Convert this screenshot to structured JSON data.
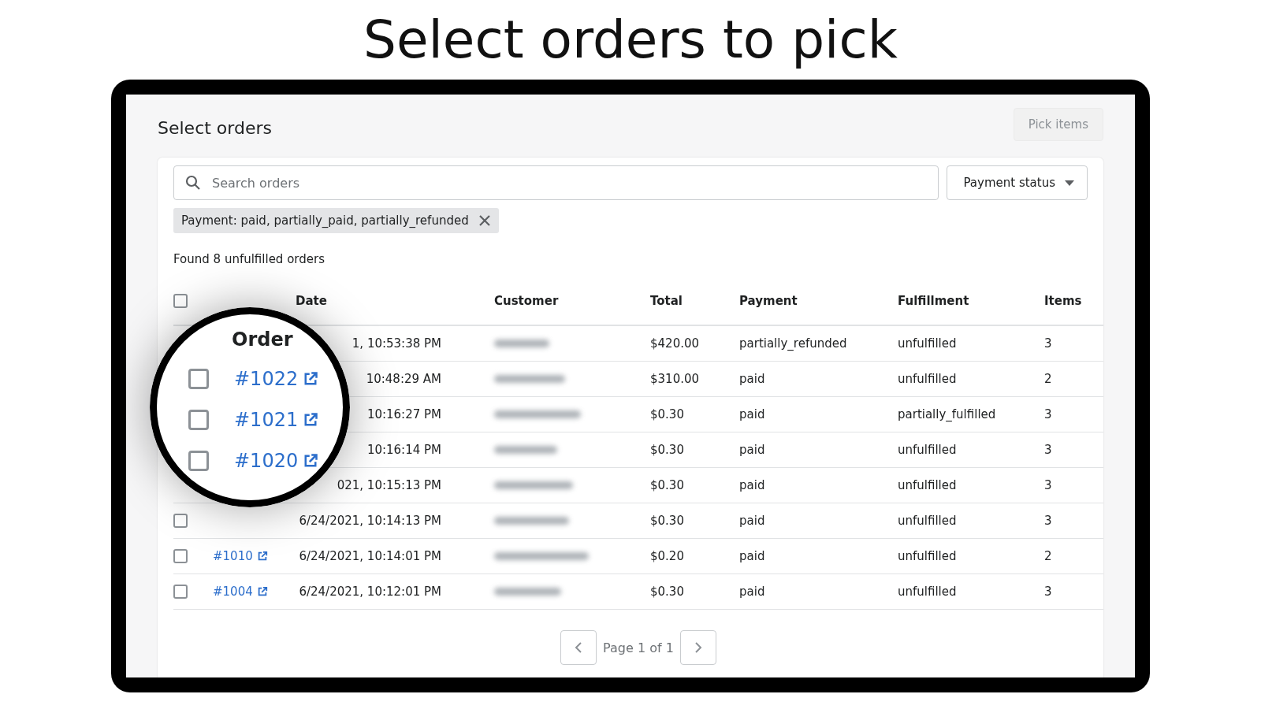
{
  "heading": "Select orders to pick",
  "page": {
    "title": "Select orders",
    "pick_button": {
      "label": "Pick items",
      "disabled": true
    }
  },
  "search": {
    "placeholder": "Search orders"
  },
  "payment_filter": {
    "label": "Payment status"
  },
  "filter_chip": {
    "label": "Payment: paid, partially_paid, partially_refunded"
  },
  "found_text": "Found 8 unfulfilled orders",
  "table": {
    "select_all": {
      "checked": false
    },
    "columns": [
      "Date",
      "Customer",
      "Total",
      "Payment",
      "Fulfillment",
      "Items"
    ],
    "rows": [
      {
        "date": "1, 10:53:38 PM",
        "total": "$420.00",
        "payment": "partially_refunded",
        "fulfillment": "unfulfilled",
        "items": "3"
      },
      {
        "date": "10:48:29 AM",
        "total": "$310.00",
        "payment": "paid",
        "fulfillment": "unfulfilled",
        "items": "2"
      },
      {
        "date": "10:16:27 PM",
        "total": "$0.30",
        "payment": "paid",
        "fulfillment": "partially_fulfilled",
        "items": "3"
      },
      {
        "date": "10:16:14 PM",
        "total": "$0.30",
        "payment": "paid",
        "fulfillment": "unfulfilled",
        "items": "3"
      },
      {
        "date": "021, 10:15:13 PM",
        "total": "$0.30",
        "payment": "paid",
        "fulfillment": "unfulfilled",
        "items": "3"
      },
      {
        "checked": false,
        "date": "6/24/2021, 10:14:13 PM",
        "total": "$0.30",
        "payment": "paid",
        "fulfillment": "unfulfilled",
        "items": "3"
      },
      {
        "checked": false,
        "order": "#1010",
        "date": "6/24/2021, 10:14:01 PM",
        "total": "$0.20",
        "payment": "paid",
        "fulfillment": "unfulfilled",
        "items": "2"
      },
      {
        "checked": false,
        "order": "#1004",
        "date": "6/24/2021, 10:12:01 PM",
        "total": "$0.30",
        "payment": "paid",
        "fulfillment": "unfulfilled",
        "items": "3"
      }
    ]
  },
  "magnifier": {
    "column": "Order",
    "rows": [
      {
        "order": "#1022",
        "checked": false
      },
      {
        "order": "#1021",
        "checked": false
      },
      {
        "order": "#1020",
        "checked": false
      }
    ]
  },
  "pagination": {
    "label": "Page 1 of 1"
  }
}
